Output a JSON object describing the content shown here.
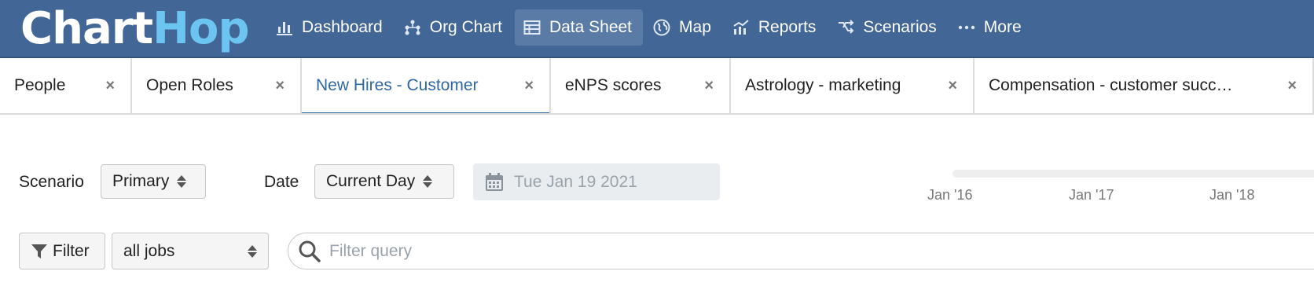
{
  "app": {
    "logo_part1": "Chart",
    "logo_part2": "Hop"
  },
  "nav": {
    "items": [
      {
        "label": "Dashboard",
        "icon": "bar-chart-icon"
      },
      {
        "label": "Org Chart",
        "icon": "org-chart-icon"
      },
      {
        "label": "Data Sheet",
        "icon": "table-icon",
        "active": true
      },
      {
        "label": "Map",
        "icon": "globe-icon"
      },
      {
        "label": "Reports",
        "icon": "reports-icon"
      },
      {
        "label": "Scenarios",
        "icon": "scenarios-icon"
      },
      {
        "label": "More",
        "icon": "more-dots-icon"
      }
    ]
  },
  "tabs": [
    {
      "label": "People",
      "close": "×"
    },
    {
      "label": "Open Roles",
      "close": "×"
    },
    {
      "label": "New Hires - Customer",
      "close": "×",
      "active": true
    },
    {
      "label": "eNPS scores",
      "close": "×"
    },
    {
      "label": "Astrology - marketing",
      "close": "×"
    },
    {
      "label": "Compensation - customer succ…",
      "close": "×"
    }
  ],
  "controls": {
    "scenario_label": "Scenario",
    "scenario_value": "Primary",
    "date_label": "Date",
    "date_value": "Current Day",
    "date_display": "Tue Jan 19 2021"
  },
  "timeline": {
    "ticks": [
      "Jan '16",
      "Jan '17",
      "Jan '18"
    ]
  },
  "filter": {
    "button_label": "Filter",
    "jobs_value": "all jobs",
    "query_placeholder": "Filter query"
  },
  "colors": {
    "nav_bg": "#426797",
    "active_tab": "#2f68a5",
    "logo_accent": "#6cc4f0"
  }
}
